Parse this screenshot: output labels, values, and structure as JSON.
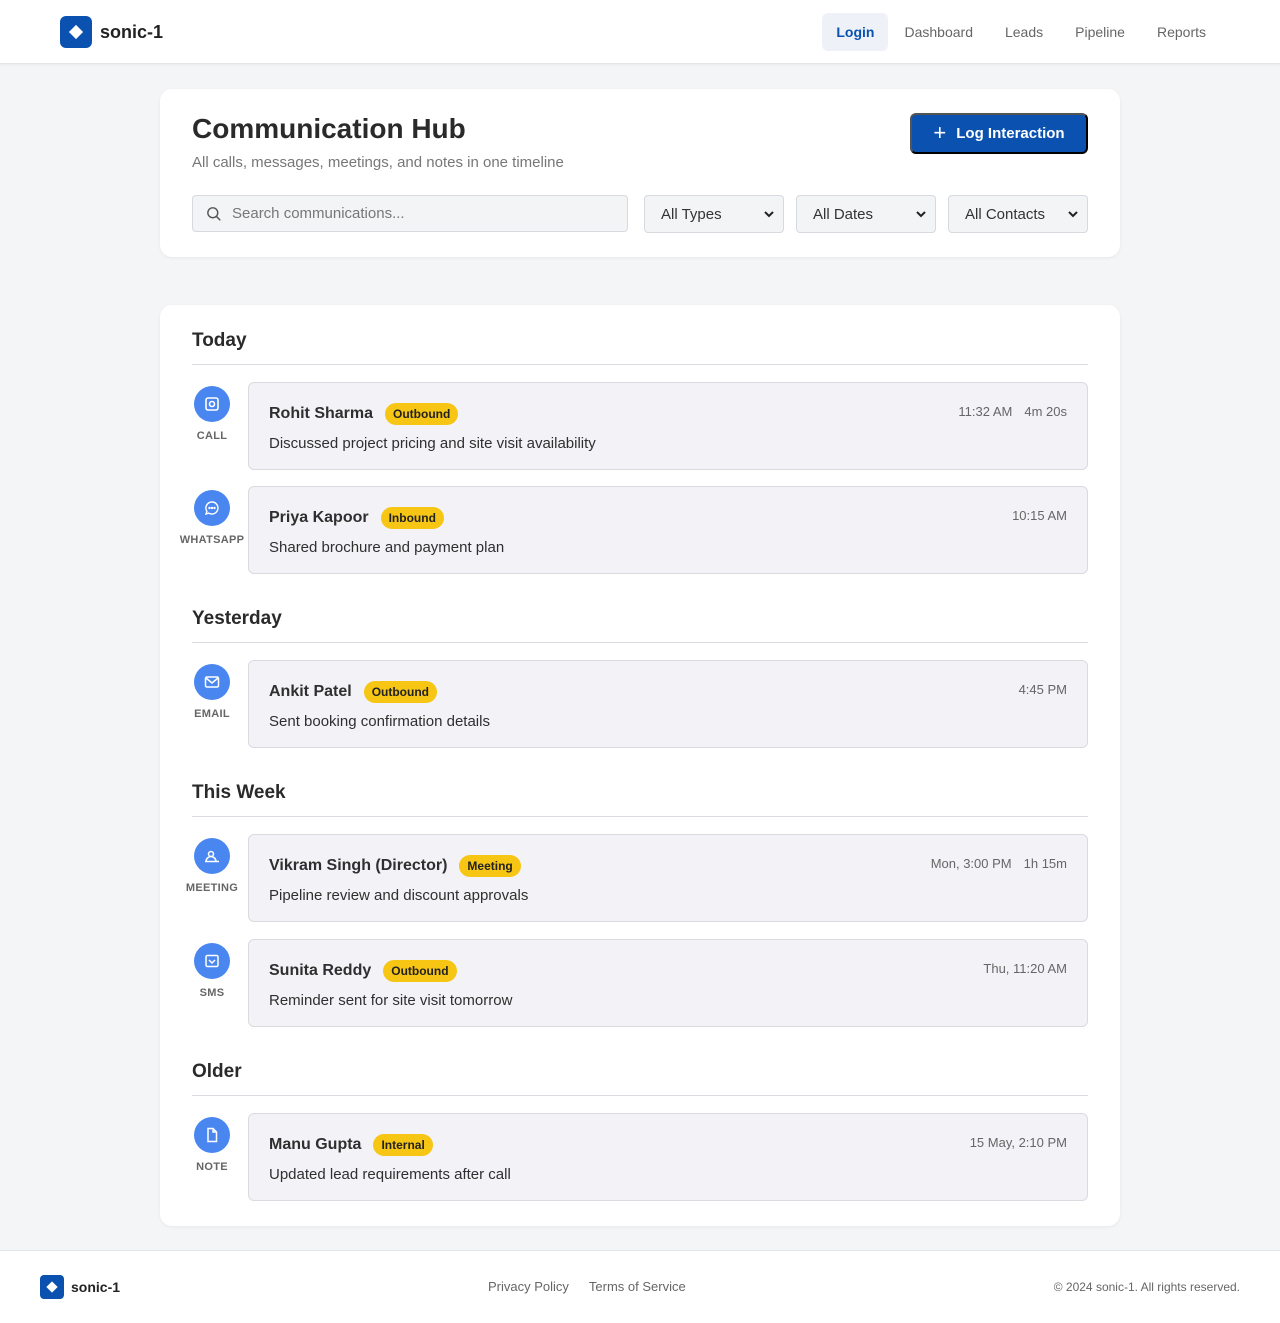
{
  "brand": {
    "name": "sonic-1",
    "icon": "diamond-logo-icon",
    "color": "#0b52b0"
  },
  "nav": [
    {
      "label": "Login",
      "active": true
    },
    {
      "label": "Dashboard",
      "active": false
    },
    {
      "label": "Leads",
      "active": false
    },
    {
      "label": "Pipeline",
      "active": false
    },
    {
      "label": "Reports",
      "active": false
    }
  ],
  "hub": {
    "title": "Communication Hub",
    "subtitle": "All calls, messages, meetings, and notes in one timeline",
    "log_button": "Log Interaction",
    "search_placeholder": "Search communications...",
    "filters": {
      "types": "All Types",
      "dates": "All Dates",
      "contacts": "All Contacts"
    }
  },
  "groups": [
    {
      "title": "Today",
      "entries": [
        {
          "type": "CALL",
          "icon": "phone-icon",
          "contact": "Rohit Sharma",
          "badge": "Outbound",
          "time": "11:32 AM",
          "duration": "4m 20s",
          "summary": "Discussed project pricing and site visit availability"
        },
        {
          "type": "WHATSAPP",
          "icon": "chat-bubble-icon",
          "contact": "Priya Kapoor",
          "badge": "Inbound",
          "time": "10:15 AM",
          "duration": "",
          "summary": "Shared brochure and payment plan"
        }
      ]
    },
    {
      "title": "Yesterday",
      "entries": [
        {
          "type": "EMAIL",
          "icon": "envelope-icon",
          "contact": "Ankit Patel",
          "badge": "Outbound",
          "time": "4:45 PM",
          "duration": "",
          "summary": "Sent booking confirmation details"
        }
      ]
    },
    {
      "title": "This Week",
      "entries": [
        {
          "type": "MEETING",
          "icon": "meeting-icon",
          "contact": "Vikram Singh (Director)",
          "badge": "Meeting",
          "time": "Mon, 3:00 PM",
          "duration": "1h 15m",
          "summary": "Pipeline review and discount approvals"
        },
        {
          "type": "SMS",
          "icon": "sms-icon",
          "contact": "Sunita Reddy",
          "badge": "Outbound",
          "time": "Thu, 11:20 AM",
          "duration": "",
          "summary": "Reminder sent for site visit tomorrow"
        }
      ]
    },
    {
      "title": "Older",
      "entries": [
        {
          "type": "NOTE",
          "icon": "note-icon",
          "contact": "Manu Gupta",
          "badge": "Internal",
          "time": "15 May, 2:10 PM",
          "duration": "",
          "summary": "Updated lead requirements after call"
        }
      ]
    }
  ],
  "footer": {
    "brand": "sonic-1",
    "links": [
      "Privacy Policy",
      "Terms of Service"
    ],
    "copyright": "© 2024 sonic-1. All rights reserved."
  },
  "colors": {
    "primary": "#0b52b0",
    "type_icon": "#4a86f0",
    "badge": "#f7c513",
    "page_bg": "#f4f5f7"
  }
}
